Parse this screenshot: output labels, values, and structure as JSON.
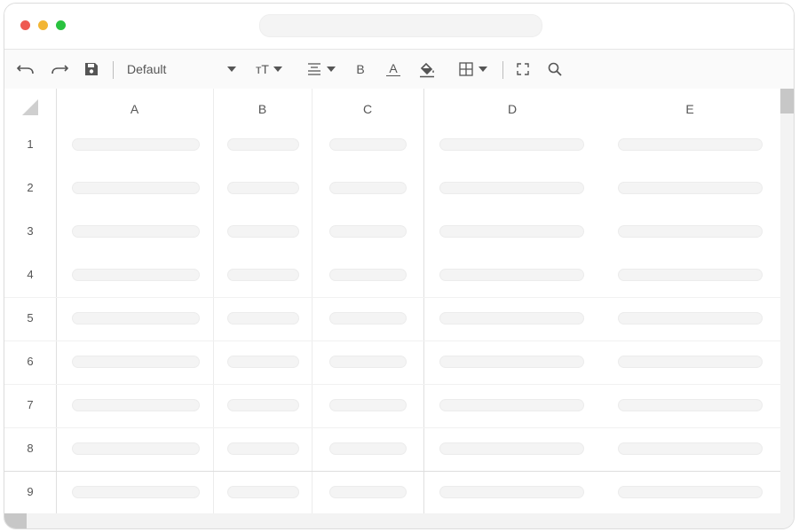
{
  "window": {
    "controls": [
      "close",
      "minimize",
      "maximize"
    ],
    "address_bar_value": ""
  },
  "toolbar": {
    "items": [
      "undo-icon",
      "redo-icon",
      "save-icon",
      "font-size-icon",
      "align-center-icon",
      "bold-icon",
      "text-color-icon",
      "fill-color-icon",
      "borders-icon",
      "fullscreen-icon",
      "search-icon"
    ],
    "font_family": "Default",
    "bold_label": "B",
    "text_color_label": "A",
    "font_size_glyph": "тT"
  },
  "sheet": {
    "columns": [
      "A",
      "B",
      "C",
      "D",
      "E"
    ],
    "rows": [
      "1",
      "2",
      "3",
      "4",
      "5",
      "6",
      "7",
      "8",
      "9"
    ]
  }
}
